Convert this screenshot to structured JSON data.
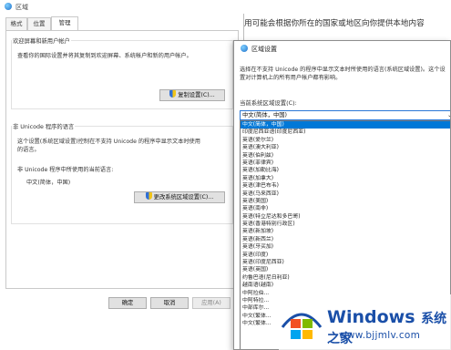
{
  "bg_window": {
    "title": "区域",
    "tabs": [
      {
        "label": "格式"
      },
      {
        "label": "位置"
      },
      {
        "label": "管理"
      }
    ],
    "welcome": {
      "group_label": "欢迎屏幕和新用户帐户",
      "description": "查看你的国际设置并将其复制到欢迎屏幕、系统帐户和新的用户帐户。",
      "copy_button": "复制设置(C)..."
    },
    "unicode": {
      "group_label": "非 Unicode 程序的语言",
      "description": [
        "这个设置(系统区域设置)控制在不支持 Unicode 的程序中显示文本时使用",
        "的语言。"
      ],
      "current_label": "非 Unicode 程序中所使用的当前语言:",
      "current_value": "中文(简体，中国)",
      "change_button": "更改系统区域设置(C)..."
    },
    "buttons": {
      "ok": "确定",
      "cancel": "取消",
      "apply": "应用(A)"
    }
  },
  "page_text": "用可能会根据你所在的国家或地区向你提供本地内容",
  "dialog": {
    "title": "区域设置",
    "description": "选择在不支持 Unicode 的程序中显示文本时所使用的语言(系统区域设置)。这个设置对计算机上的所有用户帐户都有影响。",
    "current_label": "当前系统区域设置(C):",
    "select_value": "中文(简体，中国)",
    "options": [
      {
        "label": "中文(简体，中国)",
        "selected": true
      },
      {
        "label": "印度尼西亚语(印度尼西亚)"
      },
      {
        "label": "英语(爱尔兰)"
      },
      {
        "label": "英语(澳大利亚)"
      },
      {
        "label": "英语(伯利兹)"
      },
      {
        "label": "英语(菲律宾)"
      },
      {
        "label": "英语(加勒比海)"
      },
      {
        "label": "英语(加拿大)"
      },
      {
        "label": "英语(津巴布韦)"
      },
      {
        "label": "英语(马来西亚)"
      },
      {
        "label": "英语(美国)"
      },
      {
        "label": "英语(南非)"
      },
      {
        "label": "英语(特立尼达和多巴哥)"
      },
      {
        "label": "英语(香港特别行政区)"
      },
      {
        "label": "英语(新加坡)"
      },
      {
        "label": "英语(新西兰)"
      },
      {
        "label": "英语(牙买加)"
      },
      {
        "label": "英语(印度)"
      },
      {
        "label": "英语(印度尼西亚)"
      },
      {
        "label": "英语(英国)"
      },
      {
        "label": "约鲁巴语(尼日利亚)"
      },
      {
        "label": "越南语(越南)"
      },
      {
        "label": "中阿拉伯..."
      },
      {
        "label": "中阿特拉..."
      },
      {
        "label": "中部库尔..."
      },
      {
        "label": "中文(繁体..."
      },
      {
        "label": "中文(繁体..."
      }
    ]
  },
  "watermark": {
    "brand": "Windows",
    "brand_cn": "系统之家",
    "url": "www.bjjmlv.com"
  },
  "colors": {
    "accent": "#0078d7",
    "watermark": "#1a4fa8"
  }
}
